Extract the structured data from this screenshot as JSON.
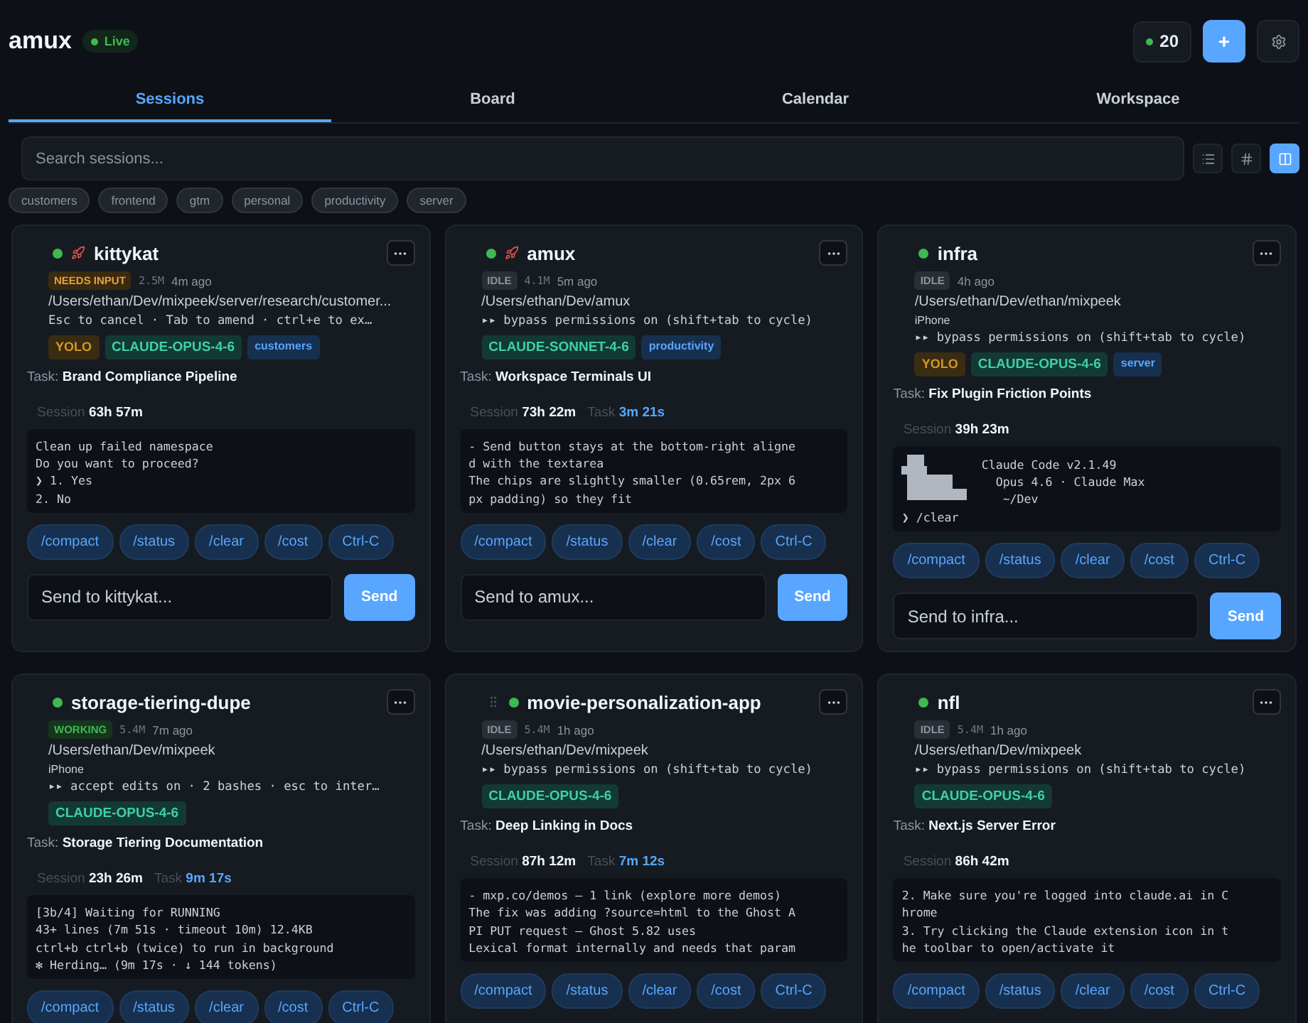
{
  "header": {
    "title": "amux",
    "live": "Live",
    "count": "20",
    "new": "+"
  },
  "tabs": [
    {
      "label": "Sessions",
      "selected": true
    },
    {
      "label": "Board",
      "selected": false
    },
    {
      "label": "Calendar",
      "selected": false
    },
    {
      "label": "Workspace",
      "selected": false
    }
  ],
  "search": {
    "placeholder": "Search sessions..."
  },
  "views": [
    {
      "kind": "list",
      "selected": false
    },
    {
      "kind": "hash",
      "selected": false
    },
    {
      "kind": "columns",
      "selected": true
    }
  ],
  "filters": [
    "customers",
    "frontend",
    "gtm",
    "personal",
    "productivity",
    "server"
  ],
  "sessions": [
    {
      "name": "kittykat",
      "handle": false,
      "pinned": true,
      "status": {
        "kind": "needs_input",
        "label": "NEEDS INPUT"
      },
      "size": "2.5M",
      "age": "4m ago",
      "path": "/Users/ethan/Dev/mixpeek/server/research/customer...",
      "prompt": "Esc to cancel · Tab to amend · ctrl+e to ex…",
      "tags": [
        {
          "kind": "yolo",
          "label": "YOLO"
        },
        {
          "kind": "model",
          "label": "CLAUDE-OPUS-4-6"
        },
        {
          "kind": "project",
          "label": "customers"
        }
      ],
      "task_label": "Task:",
      "task": "Brand Compliance Pipeline",
      "session_label": "Session",
      "session_time": "63h 57m",
      "terminal": {
        "logo": false,
        "lines": [
          "Clean up failed namespace",
          "Do you want to proceed?",
          "❯ 1. Yes",
          "2. No"
        ]
      },
      "commands": [
        "/compact",
        "/status",
        "/clear",
        "/cost",
        "Ctrl-C"
      ],
      "placeholder": "Send to kittykat...",
      "send": "Send"
    },
    {
      "name": "amux",
      "handle": false,
      "pinned": true,
      "status": {
        "kind": "idle",
        "label": "IDLE"
      },
      "size": "4.1M",
      "age": "5m ago",
      "path": "/Users/ethan/Dev/amux",
      "prompt": "▸▸ bypass permissions on (shift+tab to cycle)",
      "tags": [
        {
          "kind": "model",
          "label": "CLAUDE-SONNET-4-6"
        },
        {
          "kind": "project",
          "label": "productivity"
        }
      ],
      "task_label": "Task:",
      "task": "Workspace Terminals UI",
      "session_label": "Session",
      "session_time": "73h 22m",
      "task_time_label": "Task",
      "task_time": "3m 21s",
      "terminal": {
        "logo": false,
        "lines": [
          "- Send button stays at the bottom-right aligne",
          "d with the textarea",
          "The chips are slightly smaller (0.65rem, 2px 6",
          "px padding) so they fit"
        ]
      },
      "commands": [
        "/compact",
        "/status",
        "/clear",
        "/cost",
        "Ctrl-C"
      ],
      "placeholder": "Send to amux...",
      "send": "Send"
    },
    {
      "name": "infra",
      "handle": false,
      "pinned": false,
      "status": {
        "kind": "idle",
        "label": "IDLE"
      },
      "age": "4h ago",
      "path": "/Users/ethan/Dev/ethan/mixpeek",
      "device": "iPhone",
      "prompt": "▸▸ bypass permissions on (shift+tab to cycle)",
      "tags": [
        {
          "kind": "yolo",
          "label": "YOLO"
        },
        {
          "kind": "model",
          "label": "CLAUDE-OPUS-4-6"
        },
        {
          "kind": "project",
          "label": "server"
        }
      ],
      "task_label": "Task:",
      "task": "Fix Plugin Friction Points",
      "session_label": "Session",
      "session_time": "39h 23m",
      "terminal": {
        "logo": true,
        "banner": [
          "Claude Code v2.1.49",
          "  Opus 4.6 · Claude Max",
          "   ~/Dev"
        ],
        "lines": [
          "❯ /clear"
        ]
      },
      "commands": [
        "/compact",
        "/status",
        "/clear",
        "/cost",
        "Ctrl-C"
      ],
      "placeholder": "Send to infra...",
      "send": "Send"
    },
    {
      "name": "storage-tiering-dupe",
      "handle": false,
      "pinned": false,
      "status": {
        "kind": "working",
        "label": "WORKING"
      },
      "size": "5.4M",
      "age": "7m ago",
      "path": "/Users/ethan/Dev/mixpeek",
      "device": "iPhone",
      "prompt": "▸▸ accept edits on · 2 bashes · esc to inter…",
      "tags": [
        {
          "kind": "model",
          "label": "CLAUDE-OPUS-4-6"
        }
      ],
      "task_label": "Task:",
      "task": "Storage Tiering Documentation",
      "session_label": "Session",
      "session_time": "23h 26m",
      "task_time_label": "Task",
      "task_time": "9m 17s",
      "terminal": {
        "logo": false,
        "lines": [
          "[3b/4] Waiting for RUNNING",
          "43+ lines (7m 51s · timeout 10m) 12.4KB",
          "ctrl+b ctrl+b (twice) to run in background",
          "✻ Herding… (9m 17s · ↓ 144 tokens)"
        ]
      },
      "commands": [
        "/compact",
        "/status",
        "/clear",
        "/cost",
        "Ctrl-C"
      ]
    },
    {
      "name": "movie-personalization-app",
      "handle": true,
      "pinned": false,
      "status": {
        "kind": "idle",
        "label": "IDLE"
      },
      "size": "5.4M",
      "age": "1h ago",
      "path": "/Users/ethan/Dev/mixpeek",
      "prompt": "▸▸ bypass permissions on (shift+tab to cycle)",
      "tags": [
        {
          "kind": "model",
          "label": "CLAUDE-OPUS-4-6"
        }
      ],
      "task_label": "Task:",
      "task": "Deep Linking in Docs",
      "session_label": "Session",
      "session_time": "87h 12m",
      "task_time_label": "Task",
      "task_time": "7m 12s",
      "terminal": {
        "logo": false,
        "lines": [
          "- mxp.co/demos — 1 link (explore more demos)",
          "The fix was adding ?source=html to the Ghost A",
          "PI PUT request — Ghost 5.82 uses",
          "Lexical format internally and needs that param"
        ]
      },
      "commands": [
        "/compact",
        "/status",
        "/clear",
        "/cost",
        "Ctrl-C"
      ]
    },
    {
      "name": "nfl",
      "handle": false,
      "pinned": false,
      "status": {
        "kind": "idle",
        "label": "IDLE"
      },
      "size": "5.4M",
      "age": "1h ago",
      "path": "/Users/ethan/Dev/mixpeek",
      "prompt": "▸▸ bypass permissions on (shift+tab to cycle)",
      "tags": [
        {
          "kind": "model",
          "label": "CLAUDE-OPUS-4-6"
        }
      ],
      "task_label": "Task:",
      "task": "Next.js Server Error",
      "session_label": "Session",
      "session_time": "86h 42m",
      "terminal": {
        "logo": false,
        "lines": [
          "2. Make sure you're logged into claude.ai in C",
          "hrome",
          "3. Try clicking the Claude extension icon in t",
          "he toolbar to open/activate it"
        ]
      },
      "commands": [
        "/compact",
        "/status",
        "/clear",
        "/cost",
        "Ctrl-C"
      ]
    }
  ]
}
